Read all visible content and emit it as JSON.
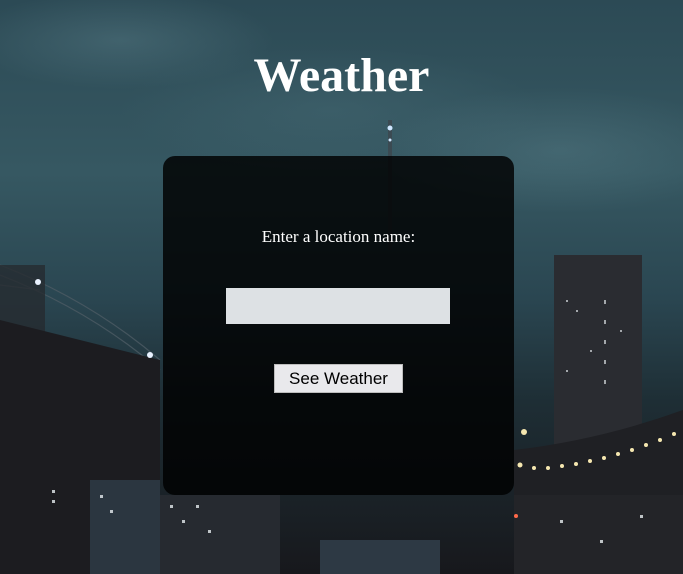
{
  "header": {
    "title": "Weather"
  },
  "form": {
    "prompt": "Enter a location name:",
    "input_value": "",
    "input_placeholder": "",
    "submit_label": "See Weather"
  },
  "colors": {
    "panel": "#000000",
    "input_bg": "#dde1e4",
    "button_bg": "#e9e9ec",
    "title": "#ffffff"
  }
}
